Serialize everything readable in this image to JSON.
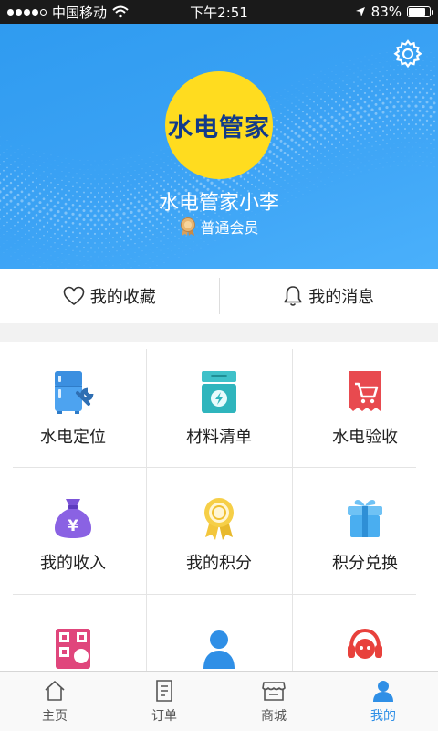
{
  "status_bar": {
    "carrier": "中国移动",
    "time": "下午2:51",
    "battery": "83%",
    "battery_level": 0.83,
    "signal_bars": 4
  },
  "profile": {
    "logo_text": "水电管家",
    "username": "水电管家小李",
    "member_level": "普通会员"
  },
  "quick_actions": [
    {
      "label": "我的收藏",
      "icon": "heart-icon"
    },
    {
      "label": "我的消息",
      "icon": "bell-icon"
    }
  ],
  "grid": [
    {
      "label": "水电定位",
      "icon": "fridge-wrench-icon"
    },
    {
      "label": "材料清单",
      "icon": "box-lightning-icon"
    },
    {
      "label": "水电验收",
      "icon": "receipt-cart-icon"
    },
    {
      "label": "我的收入",
      "icon": "money-bag-icon"
    },
    {
      "label": "我的积分",
      "icon": "medal-icon"
    },
    {
      "label": "积分兑换",
      "icon": "gift-icon"
    },
    {
      "label": "",
      "icon": "qr-code-user-icon"
    },
    {
      "label": "",
      "icon": "worker-icon"
    },
    {
      "label": "",
      "icon": "customer-service-icon"
    }
  ],
  "tabbar": [
    {
      "label": "主页",
      "icon": "home-icon",
      "active": false
    },
    {
      "label": "订单",
      "icon": "order-icon",
      "active": false
    },
    {
      "label": "商城",
      "icon": "store-icon",
      "active": false
    },
    {
      "label": "我的",
      "icon": "user-icon",
      "active": true
    }
  ],
  "colors": {
    "header_blue": "#3ca3f5",
    "logo_yellow": "#ffdc1f",
    "active_tab": "#2f8fe6"
  }
}
